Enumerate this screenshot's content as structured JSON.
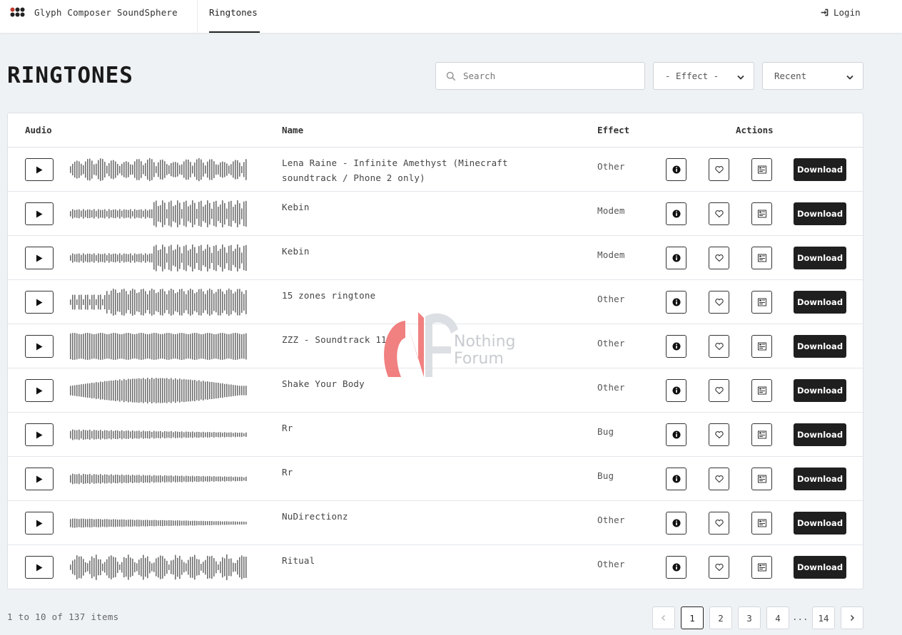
{
  "navbar": {
    "brand": "Glyph Composer SoundSphere",
    "tab": "Ringtones",
    "login": "Login"
  },
  "page": {
    "title": "RINGTONES"
  },
  "filters": {
    "search_placeholder": "Search",
    "effect_selected": "- Effect -",
    "sort_selected": "Recent"
  },
  "table": {
    "headers": {
      "audio": "Audio",
      "name": "Name",
      "effect": "Effect",
      "actions": "Actions"
    },
    "download_label": "Download",
    "rows": [
      {
        "name": "Lena Raine - Infinite Amethyst (Minecraft soundtrack / Phone 2 only)",
        "effect": "Other"
      },
      {
        "name": "Kebin",
        "effect": "Modem"
      },
      {
        "name": "Kebin",
        "effect": "Modem"
      },
      {
        "name": "15 zones ringtone",
        "effect": "Other"
      },
      {
        "name": "ZZZ - Soundtrack 11",
        "effect": "Other"
      },
      {
        "name": "Shake Your Body",
        "effect": "Other"
      },
      {
        "name": "Rr",
        "effect": "Bug"
      },
      {
        "name": "Rr",
        "effect": "Bug"
      },
      {
        "name": "NuDirectionz",
        "effect": "Other"
      },
      {
        "name": "Ritual",
        "effect": "Other"
      }
    ]
  },
  "watermark": {
    "line1": "Nothing",
    "line2": "Forum"
  },
  "pagination": {
    "summary": "1 to 10 of 137 items",
    "pages": [
      "1",
      "2",
      "3",
      "4"
    ],
    "ellipsis": "...",
    "last": "14",
    "current": "1"
  },
  "colors": {
    "background": "#eff2f5",
    "download_button": "#1f1f1f",
    "watermark_red": "#ee5a5a"
  }
}
